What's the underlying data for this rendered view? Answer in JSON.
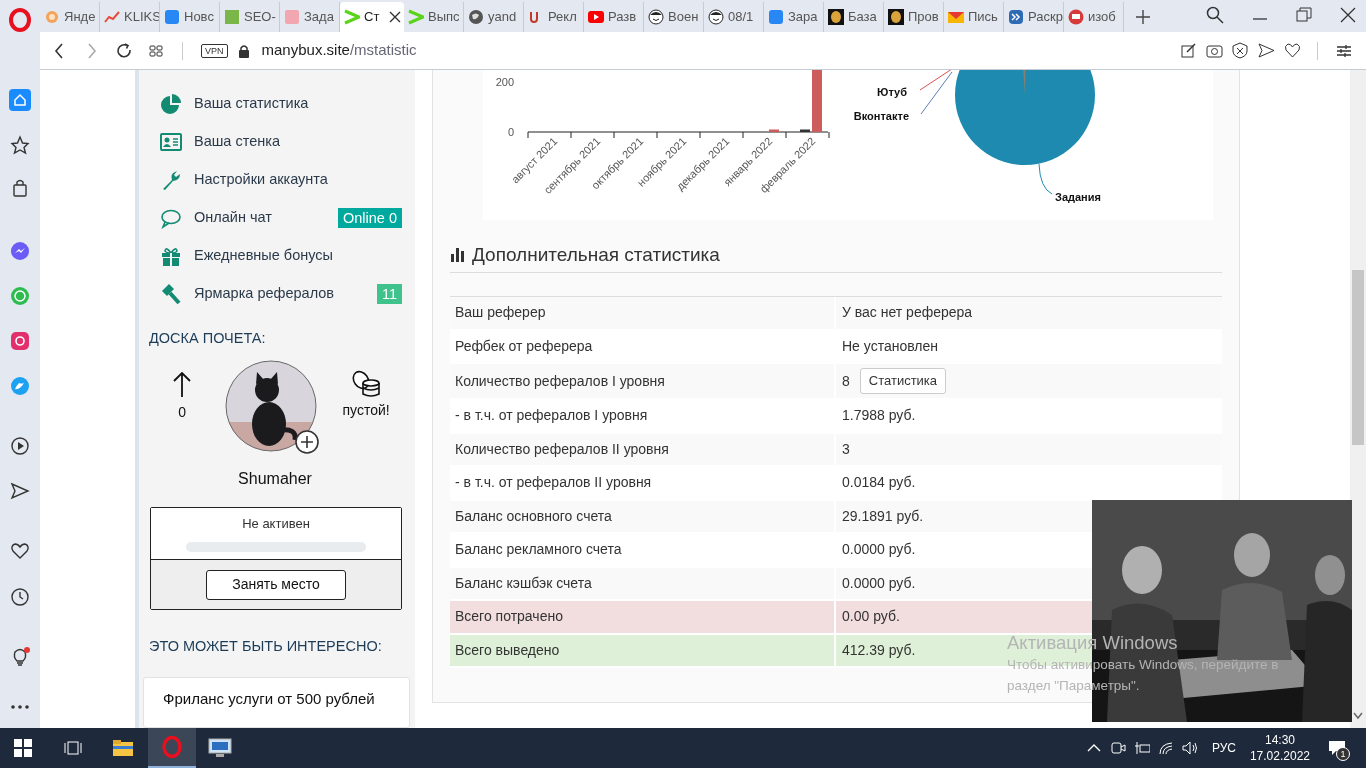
{
  "browser": {
    "tabs": [
      {
        "label": "Янде",
        "selected": false
      },
      {
        "label": "KLIKS",
        "selected": false
      },
      {
        "label": "Новс",
        "selected": false
      },
      {
        "label": "SEO-",
        "selected": false
      },
      {
        "label": "Зада",
        "selected": false
      },
      {
        "label": "Ст",
        "selected": true
      },
      {
        "label": "Выпс",
        "selected": false
      },
      {
        "label": "yand",
        "selected": false
      },
      {
        "label": "Рекл",
        "selected": false
      },
      {
        "label": "Разв",
        "selected": false
      },
      {
        "label": "Воен",
        "selected": false
      },
      {
        "label": "08/1",
        "selected": false
      },
      {
        "label": "Зара",
        "selected": false
      },
      {
        "label": "База",
        "selected": false
      },
      {
        "label": "Пров",
        "selected": false
      },
      {
        "label": "Пись",
        "selected": false
      },
      {
        "label": "Раскр",
        "selected": false
      },
      {
        "label": "изоб",
        "selected": false
      }
    ],
    "vpn": "VPN",
    "host": "manybux.site",
    "path": "/mstatistic"
  },
  "sidebar": {
    "menu": [
      {
        "label": "Ваша статистика"
      },
      {
        "label": "Ваша стенка"
      },
      {
        "label": "Настройки аккаунта"
      },
      {
        "label": "Онлайн чат",
        "badge": {
          "text": "Online 0",
          "color": "#00a99d"
        }
      },
      {
        "label": "Ежедневные бонусы"
      },
      {
        "label": "Ярмарка рефералов",
        "badge": {
          "text": "11",
          "color": "#3fc28c"
        }
      }
    ],
    "honor": {
      "title": "ДОСКА ПОЧЕТА:",
      "rank": "0",
      "coins": "пустой!",
      "name": "Shumaher",
      "status": "Не активен",
      "level": 0,
      "button": "Занять место"
    },
    "interesting": {
      "title": "ЭТО МОЖЕТ БЫТЬ ИНТЕРЕСНО:",
      "card": "Фриланс услуги от 500 рублей"
    }
  },
  "main": {
    "bar_chart": {
      "chart_data": {
        "type": "bar",
        "categories": [
          "август 2021",
          "сентябрь 2021",
          "октябрь 2021",
          "ноябрь 2021",
          "декабрь 2021",
          "январь 2022",
          "февраль 2022"
        ],
        "yticks": [
          0,
          200
        ],
        "ylim": [
          0,
          248
        ],
        "series": [
          {
            "color": "#333333",
            "values": [
              0,
              0,
              0,
              0,
              0,
              0,
              10
            ]
          },
          {
            "color": "#cd5c5c",
            "values": [
              0,
              0,
              0,
              0,
              0,
              10,
              248
            ]
          }
        ]
      }
    },
    "pie_labels": [
      "Ютуб",
      "Вконтакте",
      "Задания"
    ],
    "section_title": "Дополнительная статистика",
    "rows": [
      {
        "label": "Ваш реферер",
        "value": "У вас нет реферера"
      },
      {
        "label": "Рефбек от реферера",
        "value": "Не установлен"
      },
      {
        "label": "Количество рефералов I уровня",
        "value": "8",
        "button": "Статистика"
      },
      {
        "label": "- в т.ч. от рефералов I уровня",
        "value": "1.7988 руб."
      },
      {
        "label": "Количество рефералов II уровня",
        "value": "3"
      },
      {
        "label": "- в т.ч. от рефералов II уровня",
        "value": "0.0184 руб."
      },
      {
        "label": "Баланс основного счета",
        "value": "29.1891 руб."
      },
      {
        "label": "Баланс рекламного счета",
        "value": "0.0000 руб."
      },
      {
        "label": "Баланс кэшбэк счета",
        "value": "0.0000 руб."
      },
      {
        "label": "Всего потрачено",
        "value": "0.00 руб.",
        "color": "#f2dede"
      },
      {
        "label": "Всего выведено",
        "value": "412.39 руб.",
        "color": "#dff0d8"
      }
    ]
  },
  "activation": {
    "title": "Активация Windows",
    "lines": [
      "Чтобы активировать Windows, перейдите в",
      "раздел \"Параметры\"."
    ]
  },
  "taskbar": {
    "lang": "РУС",
    "time": "14:30",
    "date": "17.02.2022",
    "notifications": "1"
  }
}
